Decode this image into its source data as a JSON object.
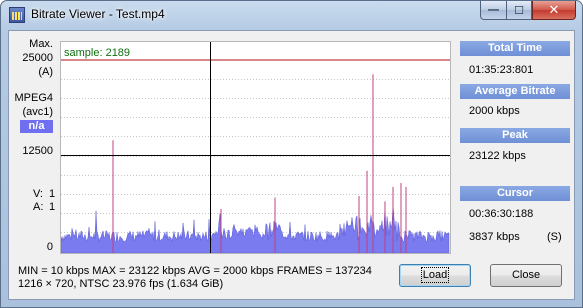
{
  "window": {
    "title": "Bitrate Viewer - Test.mp4",
    "controls": {
      "minimize": "—",
      "maximize": "☐",
      "close": "✕"
    }
  },
  "left_panel": {
    "max_label": "Max.",
    "max_value": "25000",
    "max_unit": "(A)",
    "codec": "MPEG4",
    "codec_sub": "(avc1)",
    "codec_badge": "n/a",
    "mid_value": "12500",
    "v_label": "V:",
    "v_value": "1",
    "a_label": "A:",
    "a_value": "1",
    "zero_label": "0"
  },
  "graph": {
    "sample_label": "sample: 2189",
    "max_line_color": "#b01010",
    "mid_line_color": "#000000",
    "bar_color": "#7b7bf0",
    "spike_color": "#c04080",
    "cursor_color": "#000000"
  },
  "chart_data": {
    "type": "area",
    "title": "",
    "xlabel": "",
    "ylabel": "",
    "ylim": [
      0,
      25000
    ],
    "reference_lines": [
      25000,
      12500
    ],
    "cursor_sample": 2189,
    "grid": true
  },
  "right_panel": {
    "total_time_header": "Total Time",
    "total_time_value": "01:35:23:801",
    "avg_header": "Average Bitrate",
    "avg_value": "2000 kbps",
    "peak_header": "Peak",
    "peak_value": "23122 kbps",
    "cursor_header": "Cursor",
    "cursor_time": "00:36:30:188",
    "cursor_bitrate": "3837 kbps",
    "cursor_mode": "(S)"
  },
  "footer": {
    "stats_line": "MIN = 10 kbps  MAX = 23122 kbps  AVG = 2000 kbps  FRAMES = 137234",
    "info_line": "1216 × 720, NTSC 23.976 fps     (1.634 GiB)"
  },
  "buttons": {
    "load": "Load",
    "close": "Close"
  }
}
